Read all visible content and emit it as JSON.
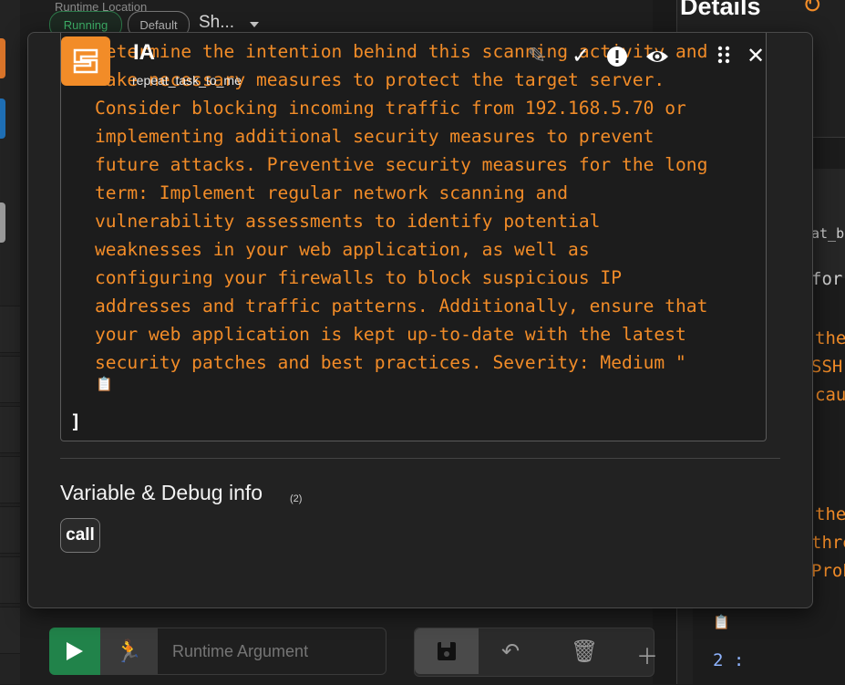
{
  "background": {
    "runtime_location_label": "Runtime Location",
    "running_pill": "Running",
    "default_pill": "Default",
    "select_value": "Sh...",
    "details_title": "Details",
    "right_snippets": [
      "at_ba",
      "for",
      "the",
      "SSH",
      "cau",
      "the",
      "thre",
      "Prob"
    ],
    "right_index_label": "2 :",
    "runtime_argument_placeholder": "Runtime Argument"
  },
  "modal": {
    "app_name": "IA",
    "app_subtitle": "repeat_task_to_me",
    "code_text": "Determine the intention behind this scanning activity and\ntake necessary measures to protect the target server.\nConsider blocking incoming traffic from 192.168.5.70 or\nimplementing additional security measures to prevent\nfuture attacks. Preventive security measures for the long\nterm: Implement regular network scanning and\nvulnerability assessments to identify potential\nweaknesses in your web application, as well as\nconfiguring your firewalls to block suspicious IP\naddresses and traffic patterns. Additionally, ensure that\nyour web application is kept up-to-date with the latest\nsecurity patches and best practices. Severity: Medium \"",
    "closing_bracket": "]",
    "variables_title": "Variable & Debug info",
    "variables_count": "(2)",
    "call_chip": "call"
  },
  "colors": {
    "accent_orange": "#f28c28",
    "success_green": "#21834a"
  },
  "icons": [
    "refresh-icon",
    "magic-wand-icon",
    "check-icon",
    "alert-icon",
    "eye-icon",
    "drag-handle-icon",
    "close-icon",
    "clipboard-icon",
    "play-icon",
    "run-icon",
    "save-icon",
    "undo-icon",
    "trash-icon",
    "plus-icon"
  ]
}
